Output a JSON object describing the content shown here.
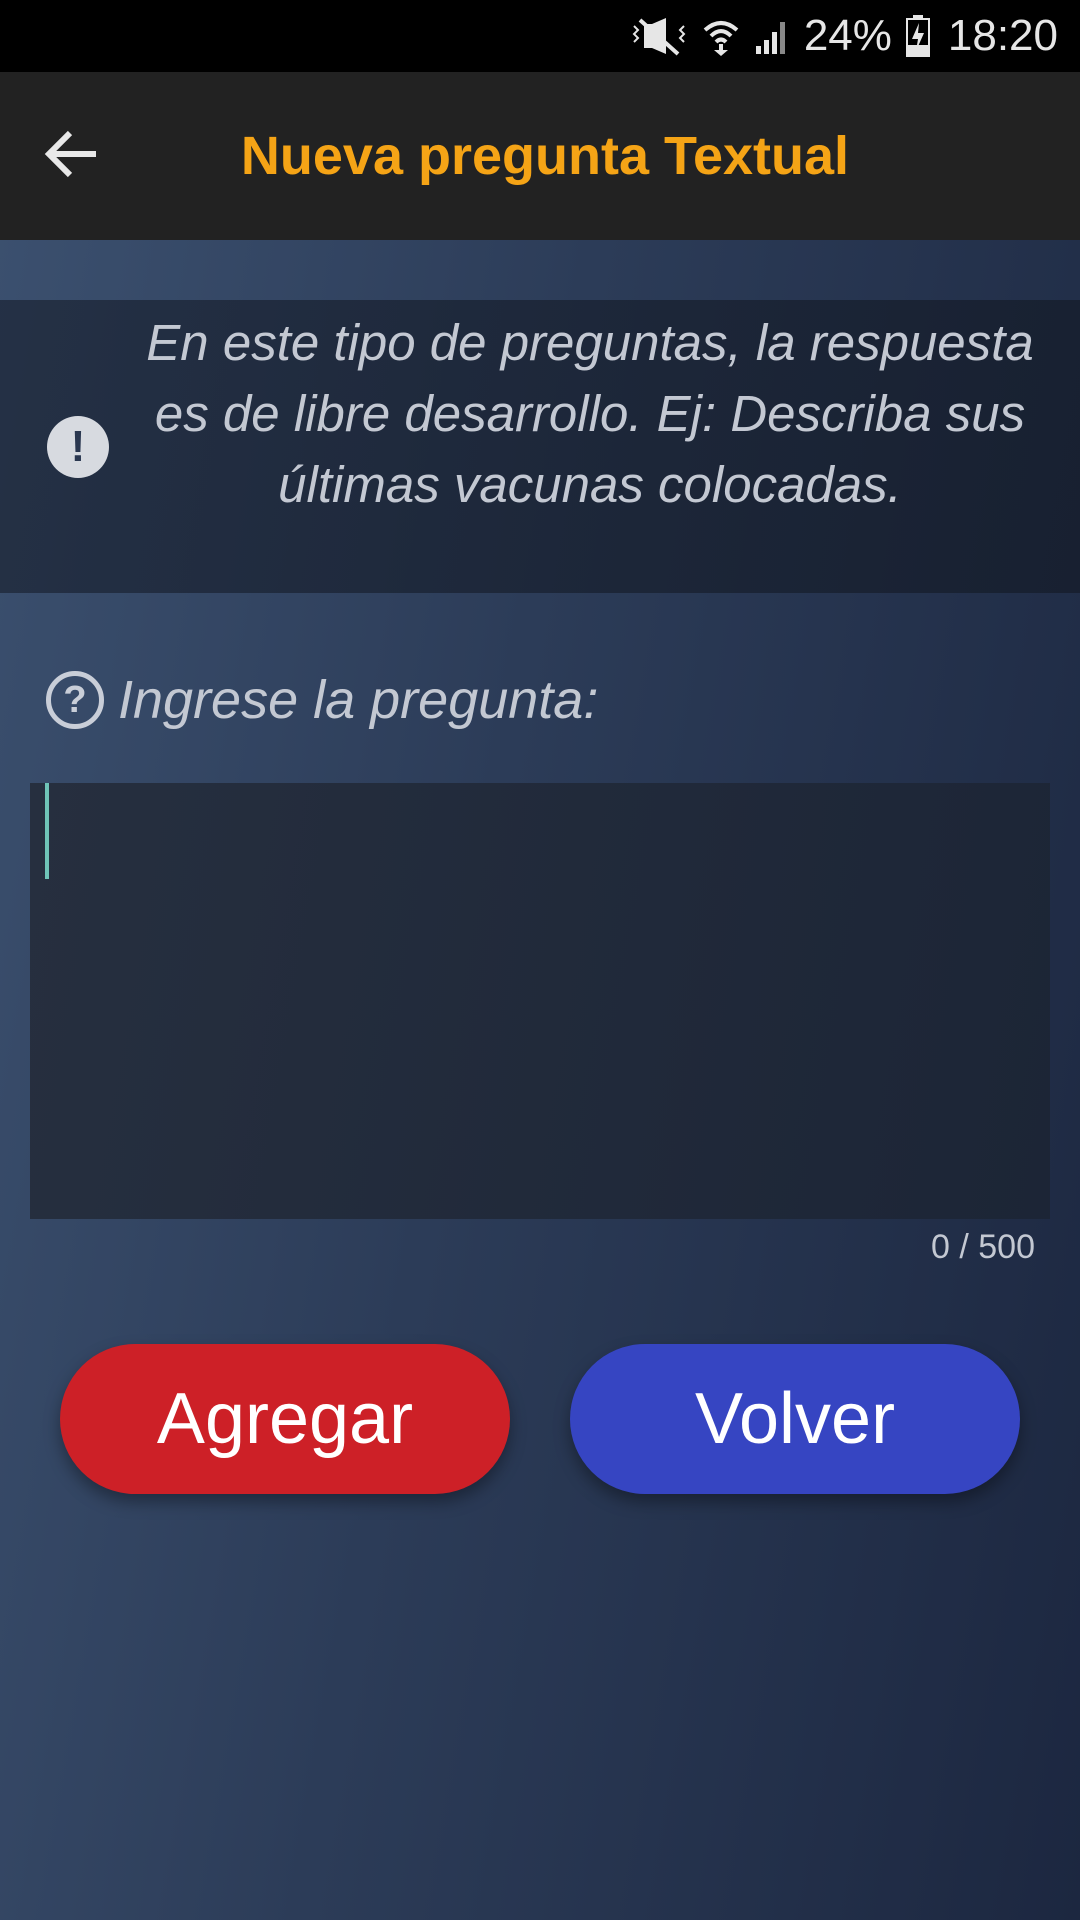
{
  "status_bar": {
    "battery_percent": "24%",
    "time": "18:20",
    "icons": [
      "mute-icon",
      "wifi-icon",
      "signal-icon",
      "battery-charging-icon"
    ]
  },
  "app_bar": {
    "title": "Nueva pregunta Textual",
    "back_icon": "arrow-left-icon",
    "title_color": "#f5a416"
  },
  "info": {
    "icon": "exclamation-icon",
    "text": "En este tipo de preguntas, la respuesta es de libre desarrollo. Ej: Describa sus últimas vacunas colocadas."
  },
  "question": {
    "icon": "question-circle-icon",
    "label": "Ingrese la pregunta:",
    "value": "",
    "counter": "0 / 500"
  },
  "buttons": {
    "add_label": "Agregar",
    "back_label": "Volver",
    "add_color": "#cd2027",
    "back_color": "#3645c2"
  }
}
